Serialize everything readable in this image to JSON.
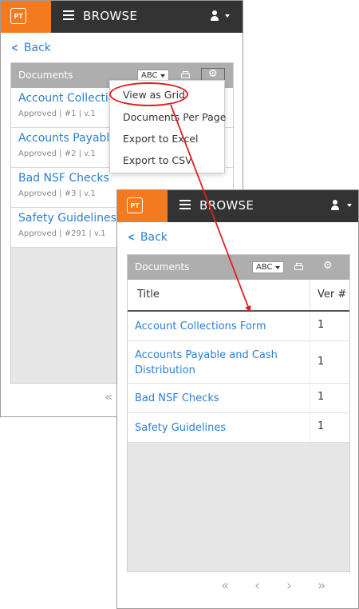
{
  "app": {
    "logo": "PT",
    "title": "BROWSE"
  },
  "nav": {
    "back_label": "Back"
  },
  "panel": {
    "label": "Documents",
    "sort_label": "ABC"
  },
  "list_items": [
    {
      "title": "Account Collections",
      "meta": "Approved | #1 | v.1"
    },
    {
      "title": "Accounts Payable a",
      "meta": "Approved | #2 | v.1"
    },
    {
      "title": "Bad NSF Checks",
      "meta": "Approved | #3 | v.1"
    },
    {
      "title": "Safety Guidelines",
      "meta": "Approved | #291 | v.1"
    }
  ],
  "menu": {
    "items": [
      "View as Grid",
      "Documents Per Page",
      "Export to Excel",
      "Export to CSV"
    ]
  },
  "grid": {
    "col_title": "Title",
    "col_ver": "Ver #",
    "rows": [
      {
        "title": "Account Collections Form",
        "ver": "1"
      },
      {
        "title": "Accounts Payable and Cash Distribution",
        "ver": "1"
      },
      {
        "title": "Bad NSF Checks",
        "ver": "1"
      },
      {
        "title": "Safety Guidelines",
        "ver": "1"
      }
    ]
  },
  "pager": {
    "first": "«",
    "prev": "‹",
    "next": "›",
    "last": "»"
  },
  "colors": {
    "brand": "#f47a20",
    "topbar": "#333333",
    "link": "#2a7fd4",
    "highlight": "#e02020"
  }
}
